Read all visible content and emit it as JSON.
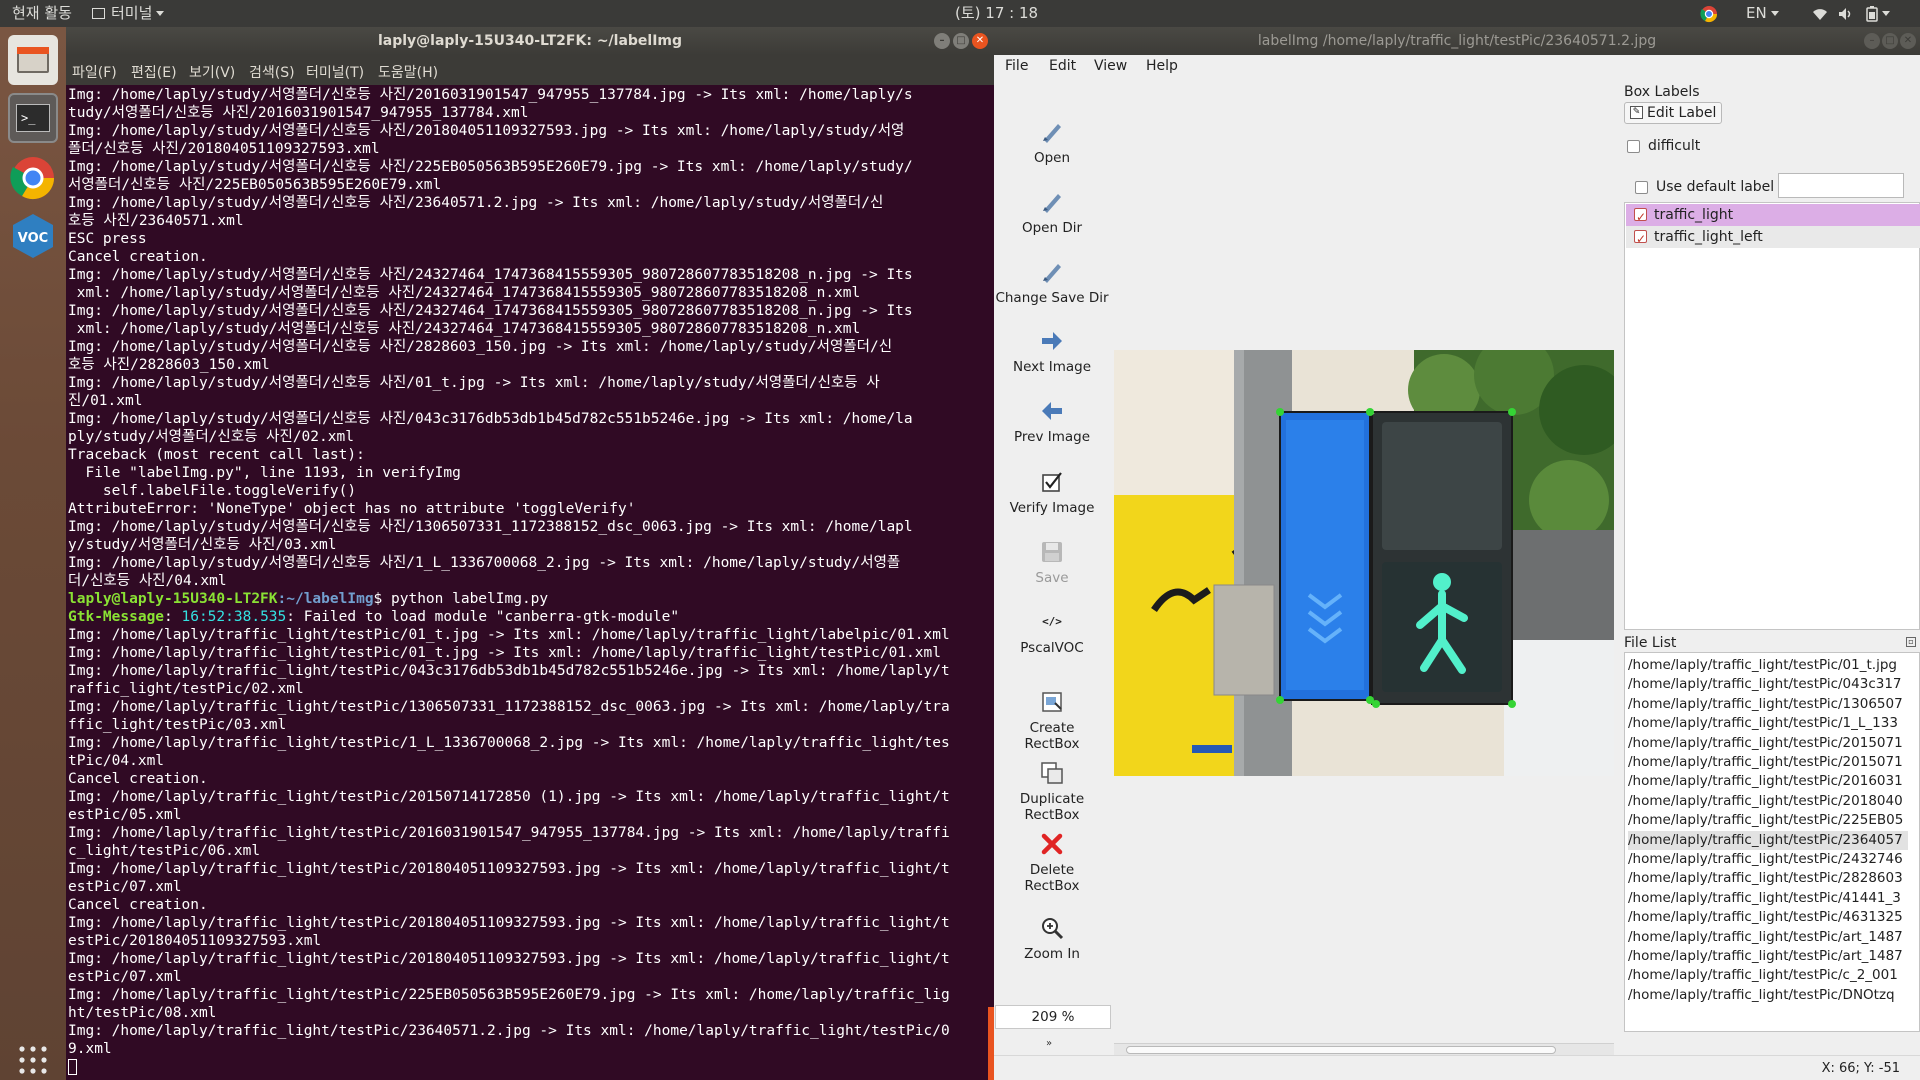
{
  "topbar": {
    "activities": "현재 활동",
    "app_menu": "터미널",
    "clock": "(토) 17 : 18",
    "lang": "EN"
  },
  "terminal": {
    "title": "laply@laply-15U340-LT2FK: ~/labelImg",
    "menu": [
      "파일(F)",
      "편집(E)",
      "보기(V)",
      "검색(S)",
      "터미널(T)",
      "도움말(H)"
    ],
    "lines": [
      "Img: /home/laply/study/서영폴더/신호등 사진/2016031901547_947955_137784.jpg -> Its xml: /home/laply/s",
      "tudy/서영폴더/신호등 사진/2016031901547_947955_137784.xml",
      "Img: /home/laply/study/서영폴더/신호등 사진/201804051109327593.jpg -> Its xml: /home/laply/study/서영",
      "폴더/신호등 사진/201804051109327593.xml",
      "Img: /home/laply/study/서영폴더/신호등 사진/225EB050563B595E260E79.jpg -> Its xml: /home/laply/study/",
      "서영폴더/신호등 사진/225EB050563B595E260E79.xml",
      "Img: /home/laply/study/서영폴더/신호등 사진/23640571.2.jpg -> Its xml: /home/laply/study/서영폴더/신",
      "호등 사진/23640571.xml",
      "ESC press",
      "Cancel creation.",
      "Img: /home/laply/study/서영폴더/신호등 사진/24327464_1747368415559305_980728607783518208_n.jpg -> Its",
      " xml: /home/laply/study/서영폴더/신호등 사진/24327464_1747368415559305_980728607783518208_n.xml",
      "Img: /home/laply/study/서영폴더/신호등 사진/24327464_1747368415559305_980728607783518208_n.jpg -> Its",
      " xml: /home/laply/study/서영폴더/신호등 사진/24327464_1747368415559305_980728607783518208_n.xml",
      "Img: /home/laply/study/서영폴더/신호등 사진/2828603_150.jpg -> Its xml: /home/laply/study/서영폴더/신",
      "호등 사진/2828603_150.xml",
      "Img: /home/laply/study/서영폴더/신호등 사진/01_t.jpg -> Its xml: /home/laply/study/서영폴더/신호등 사",
      "진/01.xml",
      "Img: /home/laply/study/서영폴더/신호등 사진/043c3176db53db1b45d782c551b5246e.jpg -> Its xml: /home/la",
      "ply/study/서영폴더/신호등 사진/02.xml",
      "Traceback (most recent call last):",
      "  File \"labelImg.py\", line 1193, in verifyImg",
      "    self.labelFile.toggleVerify()",
      "AttributeError: 'NoneType' object has no attribute 'toggleVerify'",
      "Img: /home/laply/study/서영폴더/신호등 사진/1306507331_1172388152_dsc_0063.jpg -> Its xml: /home/lapl",
      "y/study/서영폴더/신호등 사진/03.xml",
      "Img: /home/laply/study/서영폴더/신호등 사진/1_L_1336700068_2.jpg -> Its xml: /home/laply/study/서영폴",
      "더/신호등 사진/04.xml"
    ],
    "prompt_user": "laply@laply-15U340-LT2FK",
    "prompt_path": ":~/labelImg",
    "prompt_cmd": "$ python labelImg.py",
    "gtk_label": "Gtk-Message",
    "gtk_time": " 16:52:38.535",
    "gtk_text": ": Failed to load module \"canberra-gtk-module\"",
    "lines2": [
      "Img: /home/laply/traffic_light/testPic/01_t.jpg -> Its xml: /home/laply/traffic_light/labelpic/01.xml",
      "Img: /home/laply/traffic_light/testPic/01_t.jpg -> Its xml: /home/laply/traffic_light/testPic/01.xml",
      "Img: /home/laply/traffic_light/testPic/043c3176db53db1b45d782c551b5246e.jpg -> Its xml: /home/laply/t",
      "raffic_light/testPic/02.xml",
      "Img: /home/laply/traffic_light/testPic/1306507331_1172388152_dsc_0063.jpg -> Its xml: /home/laply/tra",
      "ffic_light/testPic/03.xml",
      "Img: /home/laply/traffic_light/testPic/1_L_1336700068_2.jpg -> Its xml: /home/laply/traffic_light/tes",
      "tPic/04.xml",
      "Cancel creation.",
      "Img: /home/laply/traffic_light/testPic/20150714172850 (1).jpg -> Its xml: /home/laply/traffic_light/t",
      "estPic/05.xml",
      "Img: /home/laply/traffic_light/testPic/2016031901547_947955_137784.jpg -> Its xml: /home/laply/traffi",
      "c_light/testPic/06.xml",
      "Img: /home/laply/traffic_light/testPic/201804051109327593.jpg -> Its xml: /home/laply/traffic_light/t",
      "estPic/07.xml",
      "Cancel creation.",
      "Img: /home/laply/traffic_light/testPic/201804051109327593.jpg -> Its xml: /home/laply/traffic_light/t",
      "estPic/201804051109327593.xml",
      "Img: /home/laply/traffic_light/testPic/201804051109327593.jpg -> Its xml: /home/laply/traffic_light/t",
      "estPic/07.xml",
      "Img: /home/laply/traffic_light/testPic/225EB050563B595E260E79.jpg -> Its xml: /home/laply/traffic_lig",
      "ht/testPic/08.xml",
      "Img: /home/laply/traffic_light/testPic/23640571.2.jpg -> Its xml: /home/laply/traffic_light/testPic/0",
      "9.xml"
    ]
  },
  "labelimg": {
    "title": "labelImg /home/laply/traffic_light/testPic/23640571.2.jpg",
    "menu": [
      "File",
      "Edit",
      "View",
      "Help"
    ],
    "tools": {
      "open": "Open",
      "open_dir": "Open Dir",
      "change_save_dir": "Change Save Dir",
      "next_image": "Next Image",
      "prev_image": "Prev Image",
      "verify_image": "Verify Image",
      "save": "Save",
      "format": "PscalVOC",
      "create_rectbox_1": "Create",
      "create_rectbox_2": "RectBox",
      "duplicate_rectbox_1": "Duplicate",
      "duplicate_rectbox_2": "RectBox",
      "delete_rectbox_1": "Delete",
      "delete_rectbox_2": "RectBox",
      "zoom_in": "Zoom In"
    },
    "zoom_value": "209 %",
    "box_labels": {
      "heading": "Box Labels",
      "edit_label": "Edit Label",
      "difficult": "difficult",
      "use_default_label": "Use default label",
      "default_label_value": "",
      "labels": [
        {
          "text": "traffic_light",
          "checked": true,
          "selected": true
        },
        {
          "text": "traffic_light_left",
          "checked": true,
          "selected": false
        }
      ]
    },
    "file_list": {
      "heading": "File List",
      "items": [
        "/home/laply/traffic_light/testPic/01_t.jpg",
        "/home/laply/traffic_light/testPic/043c317",
        "/home/laply/traffic_light/testPic/1306507",
        "/home/laply/traffic_light/testPic/1_L_133",
        "/home/laply/traffic_light/testPic/2015071",
        "/home/laply/traffic_light/testPic/2015071",
        "/home/laply/traffic_light/testPic/2016031",
        "/home/laply/traffic_light/testPic/2018040",
        "/home/laply/traffic_light/testPic/225EB05",
        "/home/laply/traffic_light/testPic/2364057",
        "/home/laply/traffic_light/testPic/2432746",
        "/home/laply/traffic_light/testPic/2828603",
        "/home/laply/traffic_light/testPic/41441_3",
        "/home/laply/traffic_light/testPic/4631325",
        "/home/laply/traffic_light/testPic/art_1487",
        "/home/laply/traffic_light/testPic/art_1487",
        "/home/laply/traffic_light/testPic/c_2_001",
        "/home/laply/traffic_light/testPic/DNOtzq"
      ],
      "selected_index": 9
    },
    "status": "X: 66; Y: -51"
  },
  "colors": {
    "terminal_bg": "#300a24",
    "accent": "#e95420",
    "selected_label_bg": "#dcaee6",
    "box_border": "#1a1a1a",
    "handle": "#35d435"
  }
}
